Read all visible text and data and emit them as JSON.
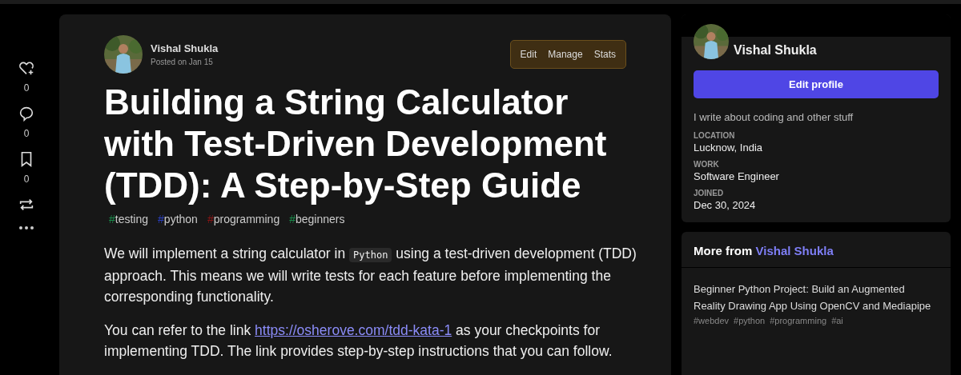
{
  "reactions": [
    {
      "kind": "heart",
      "count": "0"
    },
    {
      "kind": "comment",
      "count": "0"
    },
    {
      "kind": "bookmark",
      "count": "0"
    },
    {
      "kind": "repost"
    },
    {
      "kind": "more"
    }
  ],
  "article": {
    "author": "Vishal Shukla",
    "posted": "Posted on Jan 15",
    "actions": [
      "Edit",
      "Manage",
      "Stats"
    ],
    "title": "Building a String Calculator with Test-Driven Development (TDD): A Step-by-Step Guide",
    "tags": [
      {
        "hash": "#",
        "name": "testing",
        "color": "#1a8a4a"
      },
      {
        "hash": "#",
        "name": "python",
        "color": "#2a3fbf"
      },
      {
        "hash": "#",
        "name": "programming",
        "color": "#8a1515"
      },
      {
        "hash": "#",
        "name": "beginners",
        "color": "#1a8a4a"
      }
    ],
    "paragraphs": [
      [
        {
          "kind": "text",
          "text": "We will implement a string calculator in "
        },
        {
          "kind": "code",
          "text": "Python"
        },
        {
          "kind": "text",
          "text": " using a test-driven development (TDD) approach. This means we will write tests for each feature before implementing the corresponding functionality."
        }
      ],
      [
        {
          "kind": "text",
          "text": "You can refer to the link "
        },
        {
          "kind": "link",
          "text": "https://osherove.com/tdd-kata-1"
        },
        {
          "kind": "text",
          "text": " as your checkpoints for implementing TDD. The link provides step-by-step instructions that you can follow."
        }
      ]
    ]
  },
  "profile": {
    "name": "Vishal Shukla",
    "button": "Edit profile",
    "bio": "I write about coding and other stuff",
    "fields": [
      {
        "label": "LOCATION",
        "value": "Lucknow, India"
      },
      {
        "label": "WORK",
        "value": "Software Engineer"
      },
      {
        "label": "JOINED",
        "value": "Dec 30, 2024"
      }
    ]
  },
  "more_from": {
    "heading": "More from",
    "author": "Vishal Shukla",
    "posts": [
      {
        "title": "Beginner Python Project: Build an Augmented Reality Drawing App Using OpenCV and Mediapipe",
        "tags": [
          "#webdev",
          "#python",
          "#programming",
          "#ai"
        ]
      }
    ]
  }
}
